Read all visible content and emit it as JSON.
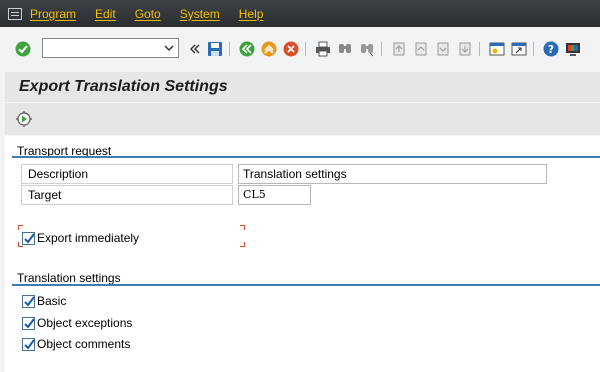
{
  "menu": {
    "items": [
      {
        "label": "Program"
      },
      {
        "label": "Edit"
      },
      {
        "label": "Goto"
      },
      {
        "label": "System"
      },
      {
        "label": "Help"
      }
    ]
  },
  "toolbar": {
    "command_field_value": ""
  },
  "screen": {
    "title": "Export Translation Settings"
  },
  "transport_request": {
    "group_title": "Transport request",
    "description_label": "Description",
    "description_value": "Translation settings",
    "target_label": "Target",
    "target_value": "CL5",
    "export_immediately_label": "Export immediately",
    "export_immediately_checked": true
  },
  "translation_settings": {
    "group_title": "Translation settings",
    "options": [
      {
        "label": "Basic",
        "checked": true
      },
      {
        "label": "Object exceptions",
        "checked": true
      },
      {
        "label": "Object comments",
        "checked": true
      }
    ]
  },
  "colors": {
    "menu_bg": "#2b2e31",
    "menu_text": "#f0c000",
    "group_line": "#427cac",
    "focus_bracket": "#d24b2a"
  }
}
